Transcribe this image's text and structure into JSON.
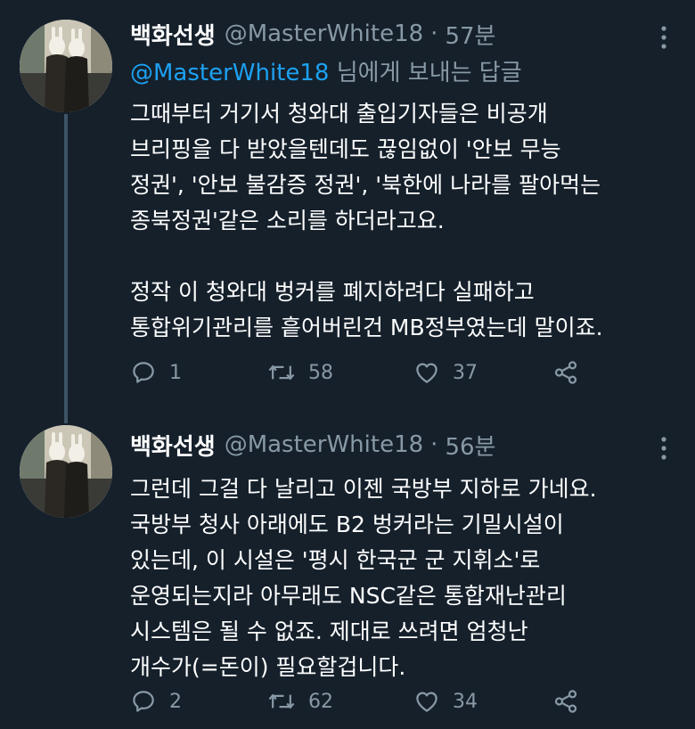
{
  "tweets": [
    {
      "display_name": "백화선생",
      "handle": "@MasterWhite18",
      "separator": "·",
      "time": "57분",
      "reply_to": {
        "mention": "@MasterWhite18",
        "suffix": " 님에게 보내는 답글"
      },
      "paragraphs": [
        [
          "그때부터 거기서 청와대 출입기자들은 비공개",
          "브리핑을 다 받았을텐데도 끊임없이 '안보 무능",
          "정권', '안보 불감증 정권', '북한에 나라를 팔아먹는",
          "종북정권'같은 소리를 하더라고요."
        ],
        [
          "정작 이 청와대 벙커를 폐지하려다 실패하고",
          "통합위기관리를 흩어버린건 MB정부였는데 말이죠."
        ]
      ],
      "actions": {
        "reply_count": "1",
        "retweet_count": "58",
        "like_count": "37"
      }
    },
    {
      "display_name": "백화선생",
      "handle": "@MasterWhite18",
      "separator": "·",
      "time": "56분",
      "paragraphs": [
        [
          "그런데 그걸 다 날리고 이젠 국방부 지하로 가네요.",
          "국방부 청사 아래에도 B2 벙커라는 기밀시설이",
          "있는데, 이 시설은 '평시 한국군 군 지휘소'로",
          "운영되는지라 아무래도 NSC같은 통합재난관리",
          "시스템은 될 수 없죠. 제대로 쓰려면 엄청난",
          "개수가(=돈이) 필요할겁니다."
        ]
      ],
      "actions": {
        "reply_count": "2",
        "retweet_count": "62",
        "like_count": "34"
      }
    }
  ],
  "icons": {
    "reply": "reply-icon",
    "retweet": "retweet-icon",
    "like": "heart-icon",
    "share": "share-icon",
    "more": "more-options-icon"
  },
  "colors": {
    "background": "#15202b",
    "text_primary": "#ffffff",
    "text_secondary": "#8899a6",
    "accent": "#1da1f2",
    "thread_line": "#3d5466"
  }
}
